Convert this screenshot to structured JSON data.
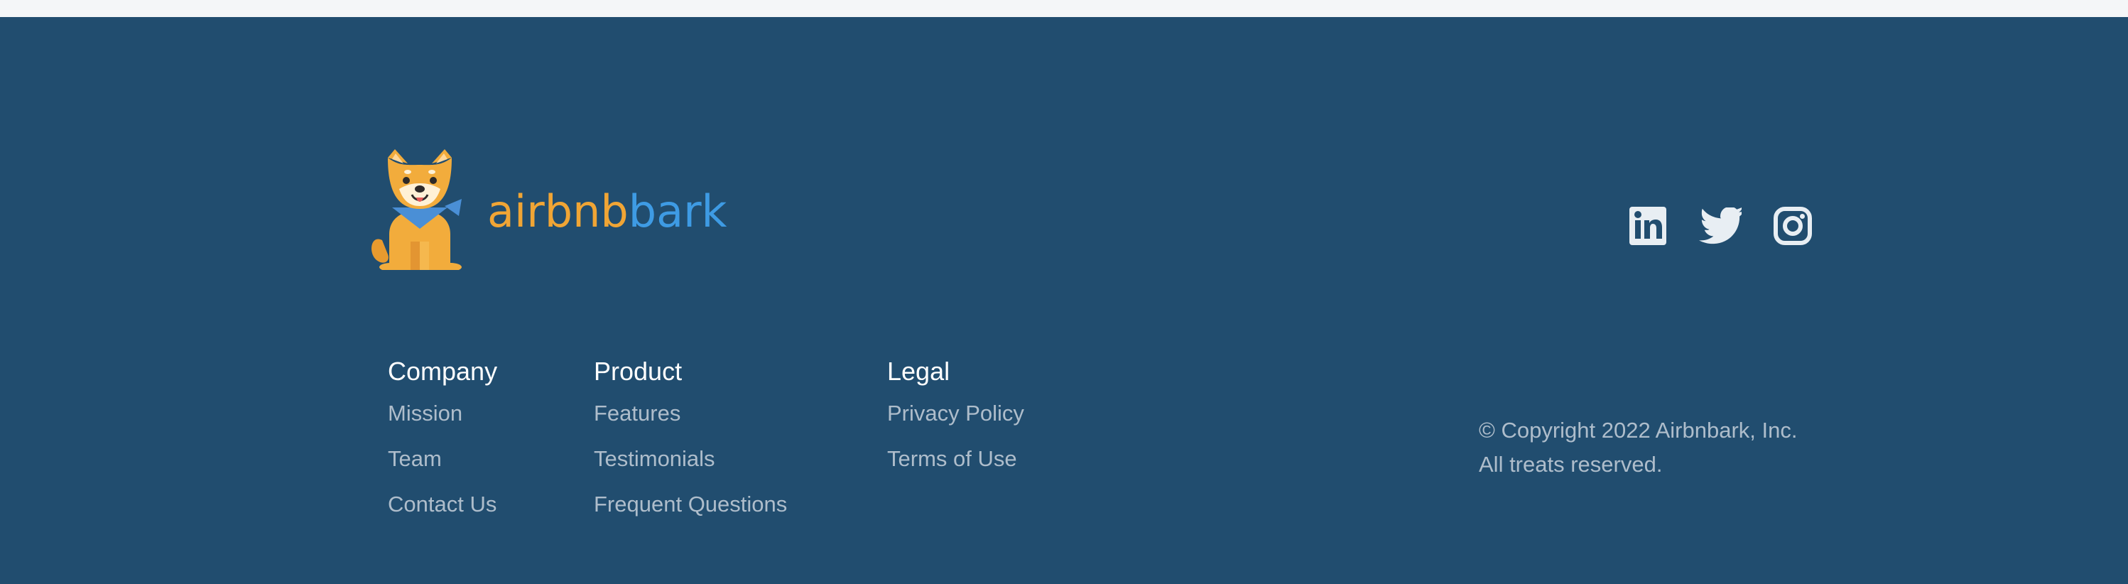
{
  "brand": {
    "name_part1": "airbnb",
    "name_part2": "ark",
    "name_part2_lead": "b",
    "colors": {
      "orange": "#f0a535",
      "blue": "#3e9be4",
      "background": "#214d6f"
    }
  },
  "socials": [
    {
      "icon": "linkedin-icon",
      "label": "LinkedIn"
    },
    {
      "icon": "twitter-icon",
      "label": "Twitter"
    },
    {
      "icon": "instagram-icon",
      "label": "Instagram"
    }
  ],
  "columns": {
    "company": {
      "title": "Company",
      "links": [
        "Mission",
        "Team",
        "Contact Us"
      ]
    },
    "product": {
      "title": "Product",
      "links": [
        "Features",
        "Testimonials",
        "Frequent Questions"
      ]
    },
    "legal": {
      "title": "Legal",
      "links": [
        "Privacy Policy",
        "Terms of Use"
      ]
    }
  },
  "copyright": {
    "line1": "© Copyright 2022 Airbnbark, Inc.",
    "line2": "All treats reserved."
  }
}
